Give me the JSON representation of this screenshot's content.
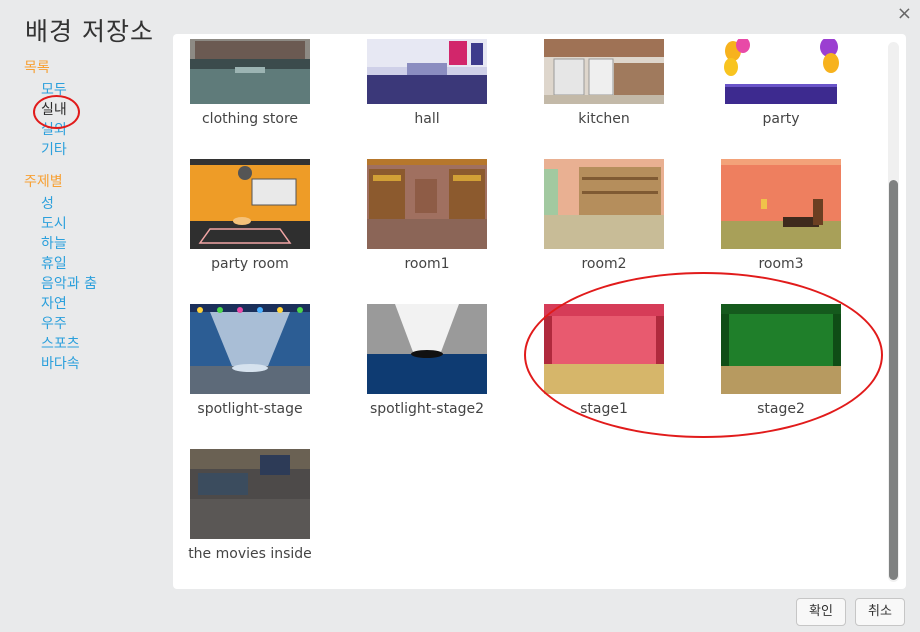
{
  "dialog": {
    "title": "배경 저장소",
    "close_glyph": "×"
  },
  "sidebar": {
    "category_heading": "목록",
    "categories": [
      "모두",
      "실내",
      "실외",
      "기타"
    ],
    "selected_category": "실내",
    "theme_heading": "주제별",
    "themes": [
      "성",
      "도시",
      "하늘",
      "휴일",
      "음악과 춤",
      "자연",
      "우주",
      "스포츠",
      "바다속"
    ]
  },
  "backdrops": [
    {
      "label": "clothing store"
    },
    {
      "label": "hall"
    },
    {
      "label": "kitchen"
    },
    {
      "label": "party"
    },
    {
      "label": "party room"
    },
    {
      "label": "room1"
    },
    {
      "label": "room2"
    },
    {
      "label": "room3"
    },
    {
      "label": "spotlight-stage"
    },
    {
      "label": "spotlight-stage2"
    },
    {
      "label": "stage1"
    },
    {
      "label": "stage2"
    },
    {
      "label": "the movies inside"
    }
  ],
  "footer": {
    "ok_label": "확인",
    "cancel_label": "취소"
  },
  "colors": {
    "accent_heading": "#f7a033",
    "link": "#2ca0dc",
    "annotation": "#e11b1b"
  }
}
